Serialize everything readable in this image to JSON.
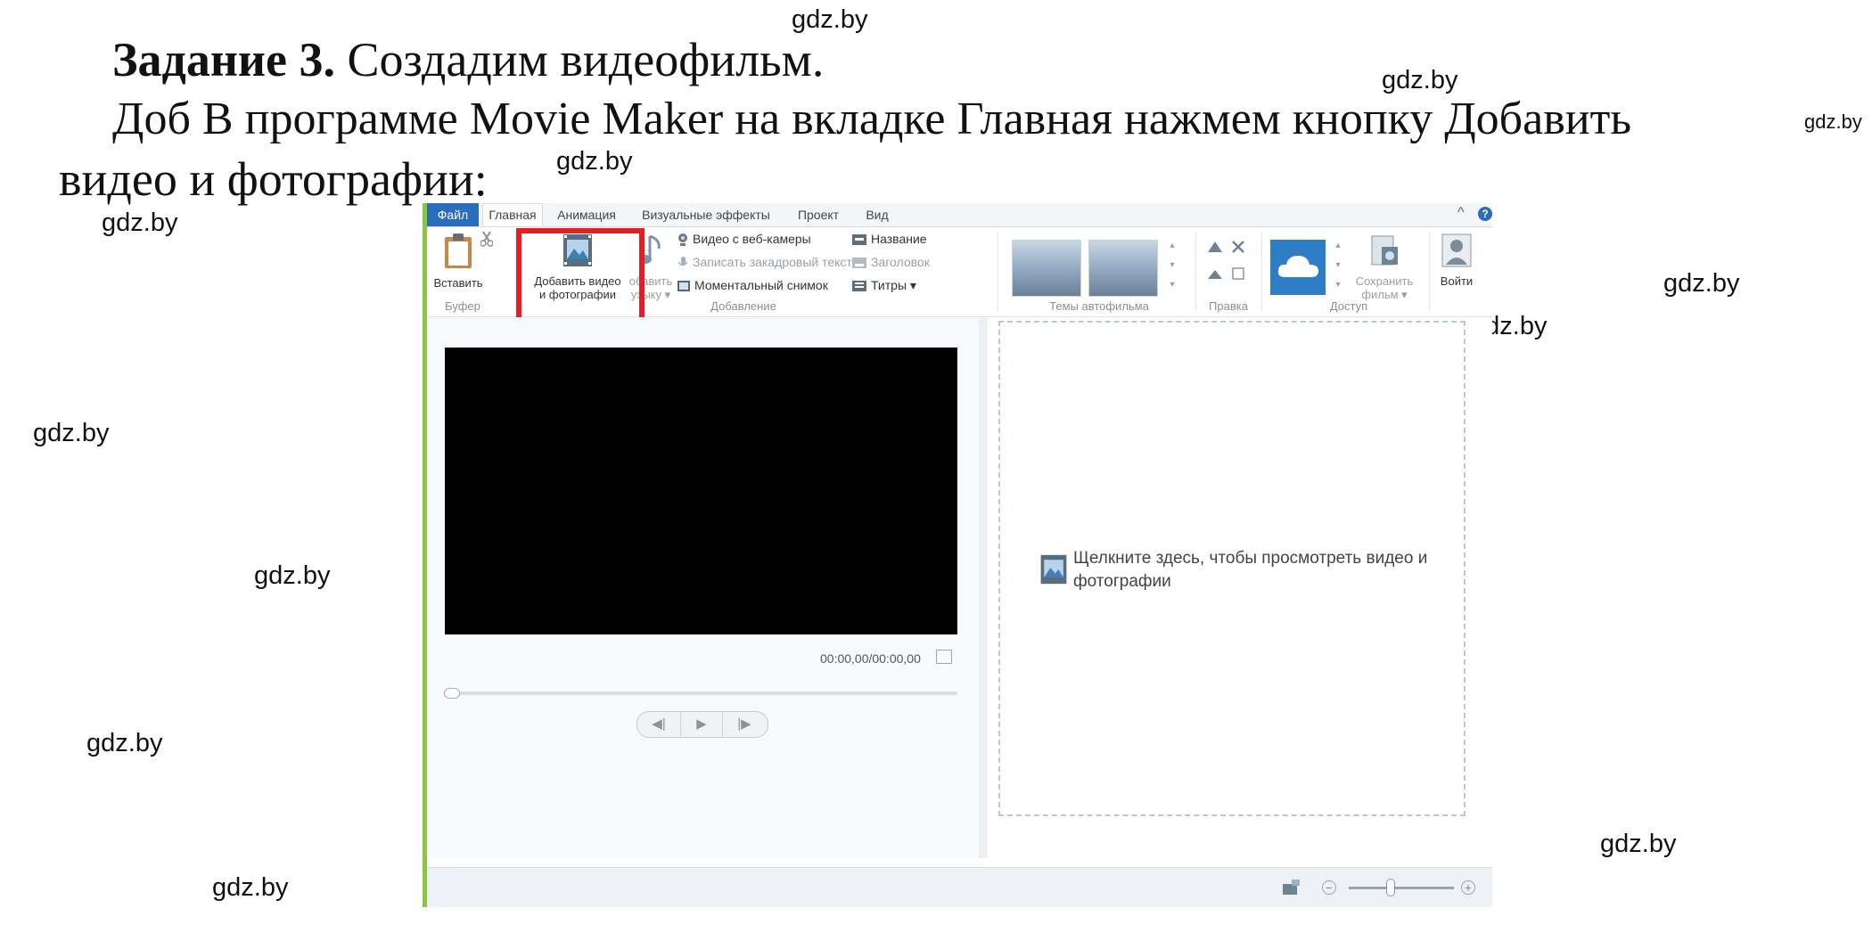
{
  "document": {
    "task_label": "Задание 3.",
    "task_title": " Создадим видеофильм.",
    "paragraph_line1": "Доб В программе Movie Maker на вкладке Главная нажмем кнопку Добавить",
    "paragraph_line2": "видео и фотографии:"
  },
  "watermark": "gdz.by",
  "app": {
    "tabs": [
      "Файл",
      "Главная",
      "Анимация",
      "Визуальные эффекты",
      "Проект",
      "Вид"
    ],
    "active_tab": "Главная",
    "help": "?",
    "collapse": "^",
    "clipboard": {
      "paste": "Вставить",
      "group": "Буфер"
    },
    "add": {
      "add_video_line1": "Добавить видео",
      "add_video_line2": "и фотографии",
      "add_music_line1": "обавить",
      "add_music_line2": "узыку ▾",
      "webcam": "Видео с веб-камеры",
      "narration": "Записать закадровый текст ▾",
      "snapshot": "Моментальный снимок",
      "title": "Название",
      "caption": "Заголовок",
      "credits": "Титры ▾",
      "group": "Добавление"
    },
    "themes": {
      "group": "Темы автофильма"
    },
    "edit": {
      "group": "Правка"
    },
    "share": {
      "save_line1": "Сохранить",
      "save_line2": "фильм ▾",
      "group": "Доступ"
    },
    "signin": "Войти",
    "preview": {
      "timecode": "00:00,00/00:00,00"
    },
    "player": {
      "prev": "◀|",
      "play": "▶",
      "next": "|▶"
    },
    "storyboard": {
      "hint_line1": "Щелкните здесь, чтобы просмотреть видео и",
      "hint_line2": "фотографии"
    },
    "status": {
      "zoom_out": "−",
      "zoom_in": "+"
    },
    "colors": {
      "file_tab": "#2a6ebb",
      "highlight": "#e31e24",
      "left_accent": "#8cc63f"
    }
  }
}
